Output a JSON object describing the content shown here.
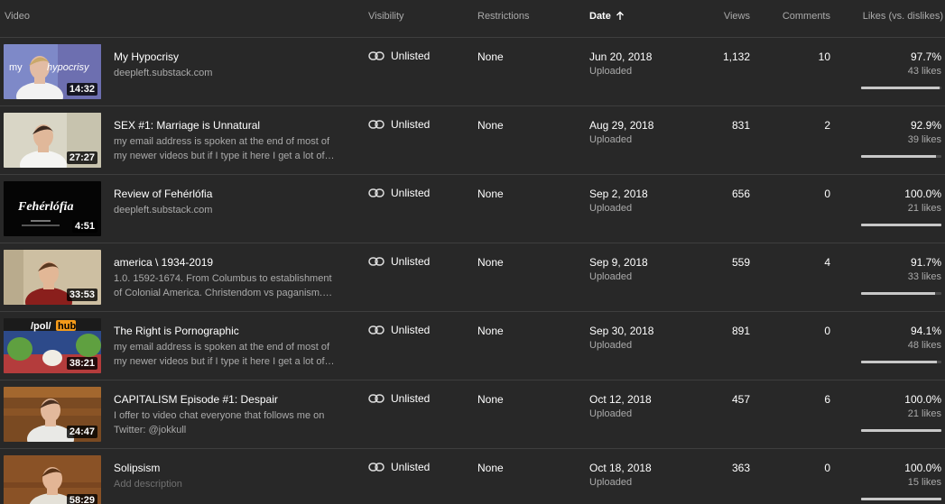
{
  "header": {
    "video": "Video",
    "visibility": "Visibility",
    "restrictions": "Restrictions",
    "date": "Date",
    "views": "Views",
    "comments": "Comments",
    "likes": "Likes (vs. dislikes)"
  },
  "colors": {
    "background": "#282828",
    "divider": "#3e3e3e",
    "secondary_text": "#aaaaaa",
    "bar_fill": "#c8c8c8",
    "bar_track": "#4a4a4a"
  },
  "rows": [
    {
      "thumb": "hypocrisy",
      "thumb_text": [
        "my",
        "hypocrisy"
      ],
      "duration": "14:32",
      "title": "My Hypocrisy",
      "description": "deepleft.substack.com",
      "visibility": "Unlisted",
      "restrictions": "None",
      "date": "Jun 20, 2018",
      "status": "Uploaded",
      "views": "1,132",
      "comments": "10",
      "like_pct": "97.7%",
      "likes": "43 likes",
      "like_fraction": 0.977
    },
    {
      "thumb": "marriage",
      "thumb_text": [],
      "duration": "27:27",
      "title": "SEX #1: Marriage is Unnatural",
      "description": "my email address is spoken at the end of most of my newer videos but if I type it here I get a lot of…",
      "visibility": "Unlisted",
      "restrictions": "None",
      "date": "Aug 29, 2018",
      "status": "Uploaded",
      "views": "831",
      "comments": "2",
      "like_pct": "92.9%",
      "likes": "39 likes",
      "like_fraction": 0.929
    },
    {
      "thumb": "feherlofia",
      "thumb_text": [
        "Fehérlófia"
      ],
      "duration": "4:51",
      "title": "Review of Fehérlófia",
      "description": "deepleft.substack.com",
      "visibility": "Unlisted",
      "restrictions": "None",
      "date": "Sep 2, 2018",
      "status": "Uploaded",
      "views": "656",
      "comments": "0",
      "like_pct": "100.0%",
      "likes": "21 likes",
      "like_fraction": 1.0
    },
    {
      "thumb": "america",
      "thumb_text": [],
      "duration": "33:53",
      "title": "america \\ 1934-2019",
      "description": "1.0. 1592-1674. From Columbus to establishment of Colonial America. Christendom vs paganism.…",
      "visibility": "Unlisted",
      "restrictions": "None",
      "date": "Sep 9, 2018",
      "status": "Uploaded",
      "views": "559",
      "comments": "4",
      "like_pct": "91.7%",
      "likes": "33 likes",
      "like_fraction": 0.917
    },
    {
      "thumb": "polhub",
      "thumb_text": [
        "/pol/",
        "hub"
      ],
      "duration": "38:21",
      "title": "The Right is Pornographic",
      "description": "my email address is spoken at the end of most of my newer videos but if I type it here I get a lot of…",
      "visibility": "Unlisted",
      "restrictions": "None",
      "date": "Sep 30, 2018",
      "status": "Uploaded",
      "views": "891",
      "comments": "0",
      "like_pct": "94.1%",
      "likes": "48 likes",
      "like_fraction": 0.941
    },
    {
      "thumb": "capitalism",
      "thumb_text": [],
      "duration": "24:47",
      "title": "CAPITALISM Episode #1: Despair",
      "description": "I offer to video chat everyone that follows me on Twitter: @jokkull",
      "visibility": "Unlisted",
      "restrictions": "None",
      "date": "Oct 12, 2018",
      "status": "Uploaded",
      "views": "457",
      "comments": "6",
      "like_pct": "100.0%",
      "likes": "21 likes",
      "like_fraction": 1.0
    },
    {
      "thumb": "solipsism",
      "thumb_text": [],
      "duration": "58:29",
      "title": "Solipsism",
      "description": "Add description",
      "description_placeholder": true,
      "visibility": "Unlisted",
      "restrictions": "None",
      "date": "Oct 18, 2018",
      "status": "Uploaded",
      "views": "363",
      "comments": "0",
      "like_pct": "100.0%",
      "likes": "15 likes",
      "like_fraction": 1.0
    }
  ]
}
